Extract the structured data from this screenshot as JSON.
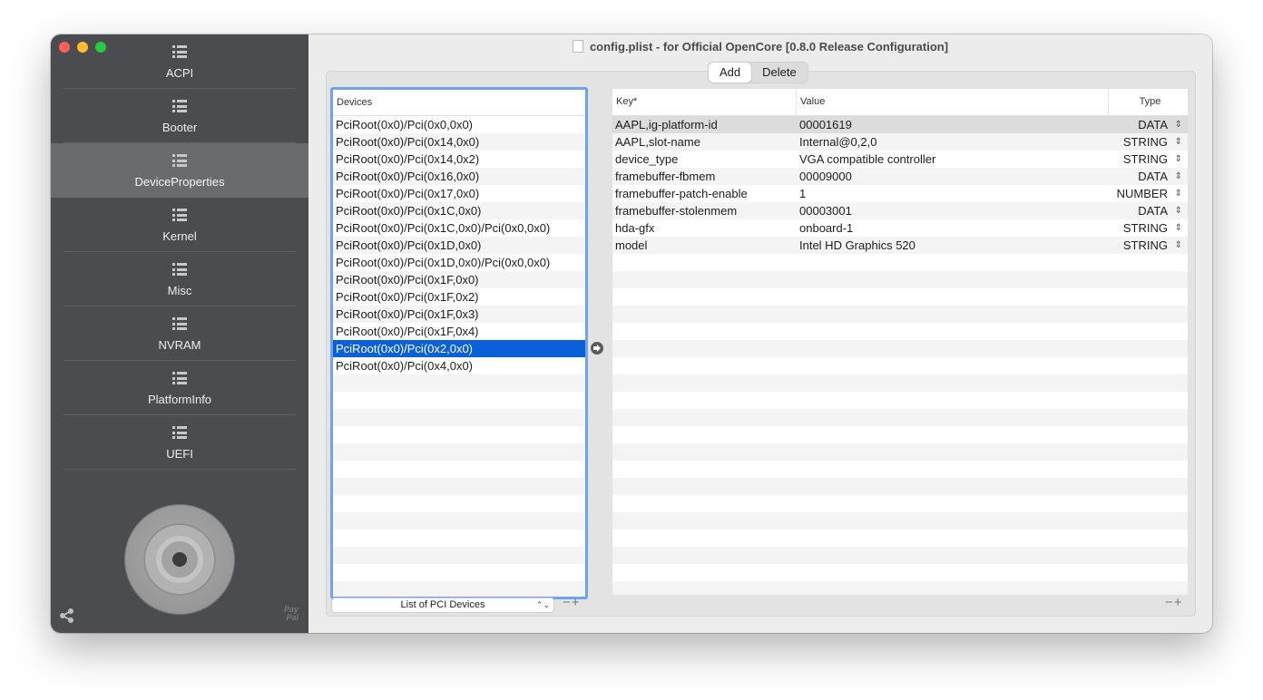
{
  "window": {
    "title": "config.plist - for Official OpenCore [0.8.0 Release Configuration]"
  },
  "sidebar": {
    "items": [
      {
        "label": "ACPI"
      },
      {
        "label": "Booter"
      },
      {
        "label": "DeviceProperties"
      },
      {
        "label": "Kernel"
      },
      {
        "label": "Misc"
      },
      {
        "label": "NVRAM"
      },
      {
        "label": "PlatformInfo"
      },
      {
        "label": "UEFI"
      }
    ],
    "active_index": 2,
    "paypal_text_1": "Pay",
    "paypal_text_2": "Pal"
  },
  "toolbar": {
    "add_label": "Add",
    "delete_label": "Delete"
  },
  "devices": {
    "header": "Devices",
    "items": [
      "PciRoot(0x0)/Pci(0x0,0x0)",
      "PciRoot(0x0)/Pci(0x14,0x0)",
      "PciRoot(0x0)/Pci(0x14,0x2)",
      "PciRoot(0x0)/Pci(0x16,0x0)",
      "PciRoot(0x0)/Pci(0x17,0x0)",
      "PciRoot(0x0)/Pci(0x1C,0x0)",
      "PciRoot(0x0)/Pci(0x1C,0x0)/Pci(0x0,0x0)",
      "PciRoot(0x0)/Pci(0x1D,0x0)",
      "PciRoot(0x0)/Pci(0x1D,0x0)/Pci(0x0,0x0)",
      "PciRoot(0x0)/Pci(0x1F,0x0)",
      "PciRoot(0x0)/Pci(0x1F,0x2)",
      "PciRoot(0x0)/Pci(0x1F,0x3)",
      "PciRoot(0x0)/Pci(0x1F,0x4)",
      "PciRoot(0x0)/Pci(0x2,0x0)",
      "PciRoot(0x0)/Pci(0x4,0x0)"
    ],
    "selected_index": 13,
    "select_value": "List of PCI Devices",
    "minus": "−",
    "plus": "+"
  },
  "properties": {
    "headers": {
      "key": "Key*",
      "value": "Value",
      "type": "Type"
    },
    "rows": [
      {
        "key": "AAPL,ig-platform-id",
        "value": "00001619",
        "type": "DATA"
      },
      {
        "key": "AAPL,slot-name",
        "value": "Internal@0,2,0",
        "type": "STRING"
      },
      {
        "key": "device_type",
        "value": "VGA compatible controller",
        "type": "STRING"
      },
      {
        "key": "framebuffer-fbmem",
        "value": "00009000",
        "type": "DATA"
      },
      {
        "key": "framebuffer-patch-enable",
        "value": "1",
        "type": "NUMBER"
      },
      {
        "key": "framebuffer-stolenmem",
        "value": "00003001",
        "type": "DATA"
      },
      {
        "key": "hda-gfx",
        "value": "onboard-1",
        "type": "STRING"
      },
      {
        "key": "model",
        "value": "Intel HD Graphics 520",
        "type": "STRING"
      }
    ],
    "selected_index": 0,
    "minus": "−",
    "plus": "+"
  },
  "icons": {
    "nav": "list-icon",
    "share": "share-icon",
    "arrow": "arrow-right-circle-icon",
    "document": "document-icon"
  }
}
